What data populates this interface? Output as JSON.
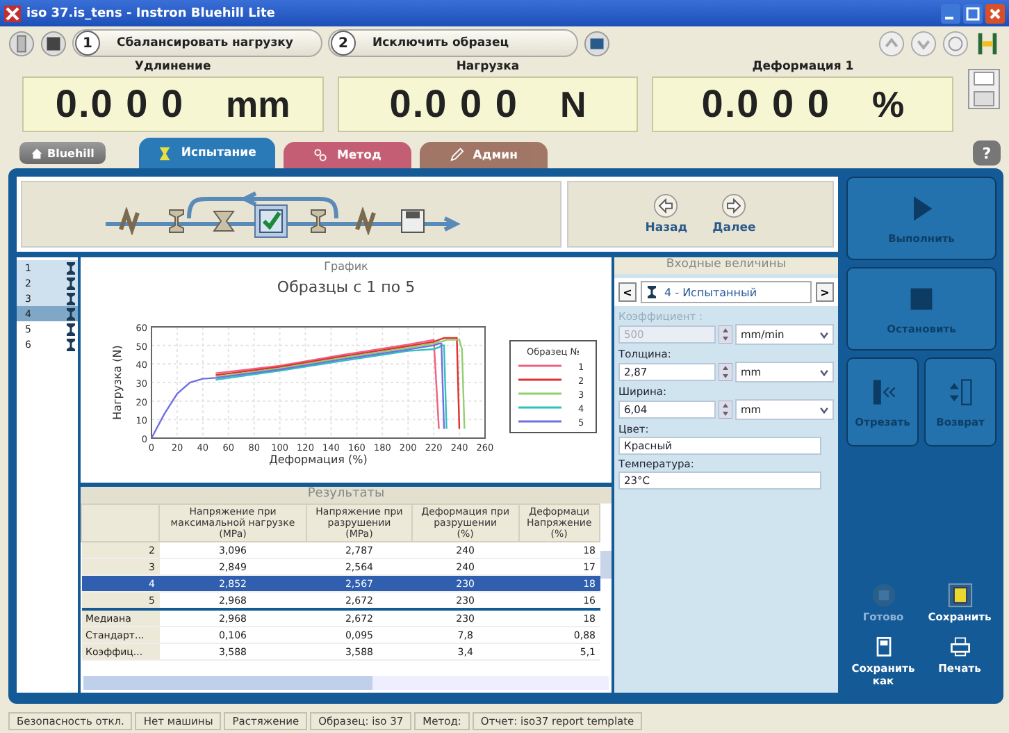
{
  "window": {
    "title": "iso 37.is_tens - Instron Bluehill Lite"
  },
  "toolbar": {
    "steps": [
      {
        "number": "1",
        "label": "Сбалансировать нагрузку"
      },
      {
        "number": "2",
        "label": "Исключить образец"
      }
    ]
  },
  "readouts": [
    {
      "label": "Удлинение",
      "value": "0.0 0 0",
      "unit": "mm"
    },
    {
      "label": "Нагрузка",
      "value": "0.0 0 0",
      "unit": "N"
    },
    {
      "label": "Деформация 1",
      "value": "0.0 0 0",
      "unit": "%"
    }
  ],
  "home": {
    "label": "Bluehill"
  },
  "tabs": [
    {
      "label": "Испытание",
      "kind": "test",
      "selected": true,
      "color": "#2a7ab8"
    },
    {
      "label": "Метод",
      "kind": "method",
      "selected": false,
      "color": "#c0506a"
    },
    {
      "label": "Админ",
      "kind": "admin",
      "selected": false,
      "color": "#9a6a5a"
    }
  ],
  "help": {
    "label": "?"
  },
  "workflow_steps": [
    {
      "kind": "grip",
      "selected": false
    },
    {
      "kind": "specimen",
      "selected": false
    },
    {
      "kind": "grip-specimen",
      "selected": false
    },
    {
      "kind": "check",
      "selected": true
    },
    {
      "kind": "specimen",
      "selected": false
    },
    {
      "kind": "grip",
      "selected": false
    },
    {
      "kind": "save",
      "selected": false
    }
  ],
  "nav": [
    {
      "kind": "back",
      "label": "Назад"
    },
    {
      "kind": "next",
      "label": "Далее"
    }
  ],
  "specimens": [
    {
      "number": "1",
      "tested": true,
      "selected": false
    },
    {
      "number": "2",
      "tested": true,
      "selected": false
    },
    {
      "number": "3",
      "tested": true,
      "selected": false
    },
    {
      "number": "4",
      "tested": true,
      "selected": true
    },
    {
      "number": "5",
      "tested": false,
      "selected": false
    },
    {
      "number": "6",
      "tested": false,
      "selected": false
    }
  ],
  "graph": {
    "panel_title": "График",
    "chart_data": {
      "type": "line",
      "title": "Образцы с 1 по 5",
      "xlabel": "Деформация (%)",
      "ylabel": "Нагрузка (N)",
      "legend": {
        "title": "Образец №"
      },
      "grid": true,
      "x": [
        0,
        10,
        20,
        30,
        40,
        50,
        100,
        150,
        200,
        220,
        224,
        226,
        228,
        230,
        232,
        236,
        238,
        240,
        242,
        244
      ],
      "series": [
        {
          "name": "1",
          "color": "#f06080",
          "values": [
            null,
            null,
            null,
            null,
            null,
            35,
            39,
            45,
            50.5,
            53,
            5,
            null,
            null,
            null,
            null,
            null,
            null,
            null,
            null,
            null
          ]
        },
        {
          "name": "2",
          "color": "#e03030",
          "values": [
            null,
            null,
            null,
            null,
            null,
            34,
            38.3,
            44.2,
            49.6,
            52,
            53,
            53.5,
            54,
            54,
            54,
            54,
            54,
            5,
            null,
            null
          ]
        },
        {
          "name": "3",
          "color": "#90d070",
          "values": [
            null,
            null,
            null,
            null,
            null,
            33,
            37.6,
            43.4,
            48.7,
            51,
            52,
            52,
            52.5,
            53,
            53,
            53,
            53,
            53,
            48,
            5
          ]
        },
        {
          "name": "4",
          "color": "#30c0c0",
          "values": [
            null,
            null,
            null,
            null,
            null,
            31.5,
            36.4,
            41.8,
            47,
            48,
            49,
            50,
            50,
            5,
            null,
            null,
            null,
            null,
            null,
            null
          ]
        },
        {
          "name": "5",
          "color": "#7070e0",
          "values": [
            0,
            13,
            24,
            30,
            32,
            32.5,
            37,
            42.6,
            47.8,
            50,
            51,
            51,
            5,
            null,
            null,
            null,
            null,
            null,
            null,
            null
          ]
        }
      ],
      "xlim": [
        0,
        260
      ],
      "ylim": [
        0,
        60
      ],
      "xticks": [
        0,
        20,
        40,
        60,
        80,
        100,
        120,
        140,
        160,
        180,
        200,
        220,
        240,
        260
      ],
      "yticks": [
        0,
        10,
        20,
        30,
        40,
        50,
        60
      ]
    }
  },
  "results": {
    "title": "Результаты",
    "columns": [
      {
        "lines": [
          "Напряжение при",
          "максимальной нагрузке",
          "(MPa)"
        ]
      },
      {
        "lines": [
          "Напряжение при",
          "разрушении",
          "(MPa)"
        ]
      },
      {
        "lines": [
          "Деформация при",
          "разрушении",
          "(%)"
        ]
      },
      {
        "lines": [
          "Деформаци",
          "Напряжение",
          "(%)"
        ]
      }
    ],
    "rows": [
      {
        "label": "2",
        "cells": [
          "3,096",
          "2,787",
          "240",
          "18"
        ],
        "selected": false
      },
      {
        "label": "3",
        "cells": [
          "2,849",
          "2,564",
          "240",
          "17"
        ],
        "selected": false
      },
      {
        "label": "4",
        "cells": [
          "2,852",
          "2,567",
          "230",
          "18"
        ],
        "selected": true
      },
      {
        "label": "5",
        "cells": [
          "2,968",
          "2,672",
          "230",
          "16"
        ],
        "selected": false
      }
    ],
    "stats": [
      {
        "label": "Медиана",
        "cells": [
          "2,968",
          "2,672",
          "230",
          "18"
        ]
      },
      {
        "label": "Стандарт...",
        "cells": [
          "0,106",
          "0,095",
          "7,8",
          "0,88"
        ]
      },
      {
        "label": "Коэффиц...",
        "cells": [
          "3,588",
          "3,588",
          "3,4",
          "5,1"
        ]
      }
    ]
  },
  "inputs": {
    "title": "Входные величины",
    "prev": "<",
    "next": ">",
    "specimen": "4 - Испытанный",
    "fields": [
      {
        "kind": "spin",
        "label": "Коэффициент :",
        "value": "500",
        "unit": "mm/min",
        "disabled": true
      },
      {
        "kind": "spin",
        "label": "Толщина:",
        "value": "2,87",
        "unit": "mm",
        "disabled": false
      },
      {
        "kind": "spin",
        "label": "Ширина:",
        "value": "6,04",
        "unit": "mm",
        "disabled": false
      },
      {
        "kind": "text",
        "label": "Цвет:",
        "value": "Красный",
        "disabled": false
      },
      {
        "kind": "text",
        "label": "Температура:",
        "value": "23°C",
        "disabled": false
      }
    ]
  },
  "controls": [
    {
      "kind": "run",
      "label": "Выполнить"
    },
    {
      "kind": "stop",
      "label": "Остановить"
    },
    {
      "kind": "cut",
      "label": "Отрезать"
    },
    {
      "kind": "return",
      "label": "Возврат"
    }
  ],
  "actions": [
    {
      "kind": "done",
      "label": "Готово",
      "disabled": true
    },
    {
      "kind": "save",
      "label": "Сохранить",
      "disabled": false
    },
    {
      "kind": "saveas",
      "label": "Сохранить как",
      "disabled": false
    },
    {
      "kind": "print",
      "label": "Печать",
      "disabled": false
    }
  ],
  "status_bar": [
    "Безопасность откл.",
    "Нет машины",
    "Растяжение",
    "Образец: iso 37",
    "Метод:",
    "Отчет: iso37 report template"
  ]
}
